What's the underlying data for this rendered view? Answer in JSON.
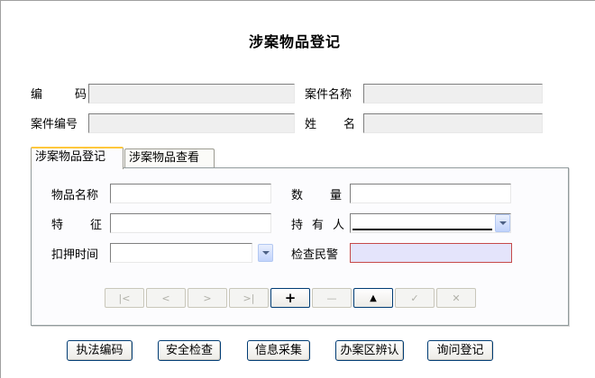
{
  "window": {
    "title": "涉案物品登记"
  },
  "header": {
    "code_label": "编码",
    "case_name_label": "案件名称",
    "case_no_label": "案件编号",
    "name_label": "姓名",
    "code_value": "",
    "case_name_value": "",
    "case_no_value": "",
    "name_value": ""
  },
  "tabs": [
    {
      "label": "涉案物品登记",
      "active": true
    },
    {
      "label": "涉案物品查看",
      "active": false
    }
  ],
  "form": {
    "item_name_label": "物品名称",
    "quantity_label": "数量",
    "feature_label": "特征",
    "holder_label": "持有人",
    "detain_time_label": "扣押时间",
    "inspector_label": "检查民警",
    "item_name_value": "",
    "quantity_value": "",
    "feature_value": "",
    "holder_value": "",
    "detain_time_value": "",
    "inspector_value": ""
  },
  "nav_buttons": [
    {
      "icon": "first-record-icon",
      "enabled": false
    },
    {
      "icon": "prev-record-icon",
      "enabled": false
    },
    {
      "icon": "next-record-icon",
      "enabled": false
    },
    {
      "icon": "last-record-icon",
      "enabled": false
    },
    {
      "icon": "add-icon",
      "enabled": true
    },
    {
      "icon": "delete-icon",
      "enabled": false
    },
    {
      "icon": "edit-icon",
      "enabled": true
    },
    {
      "icon": "save-icon",
      "enabled": false
    },
    {
      "icon": "cancel-icon",
      "enabled": false
    }
  ],
  "bottom_buttons": [
    {
      "label": "执法编码"
    },
    {
      "label": "安全检查"
    },
    {
      "label": "信息采集"
    },
    {
      "label": "办案区辨认"
    },
    {
      "label": "询问登记"
    }
  ],
  "colors": {
    "tab_accent": "#ffc83c",
    "inspector_field_bg": "#e4e4fb",
    "inspector_field_border": "#c64a4a",
    "button_border": "#003c74"
  }
}
